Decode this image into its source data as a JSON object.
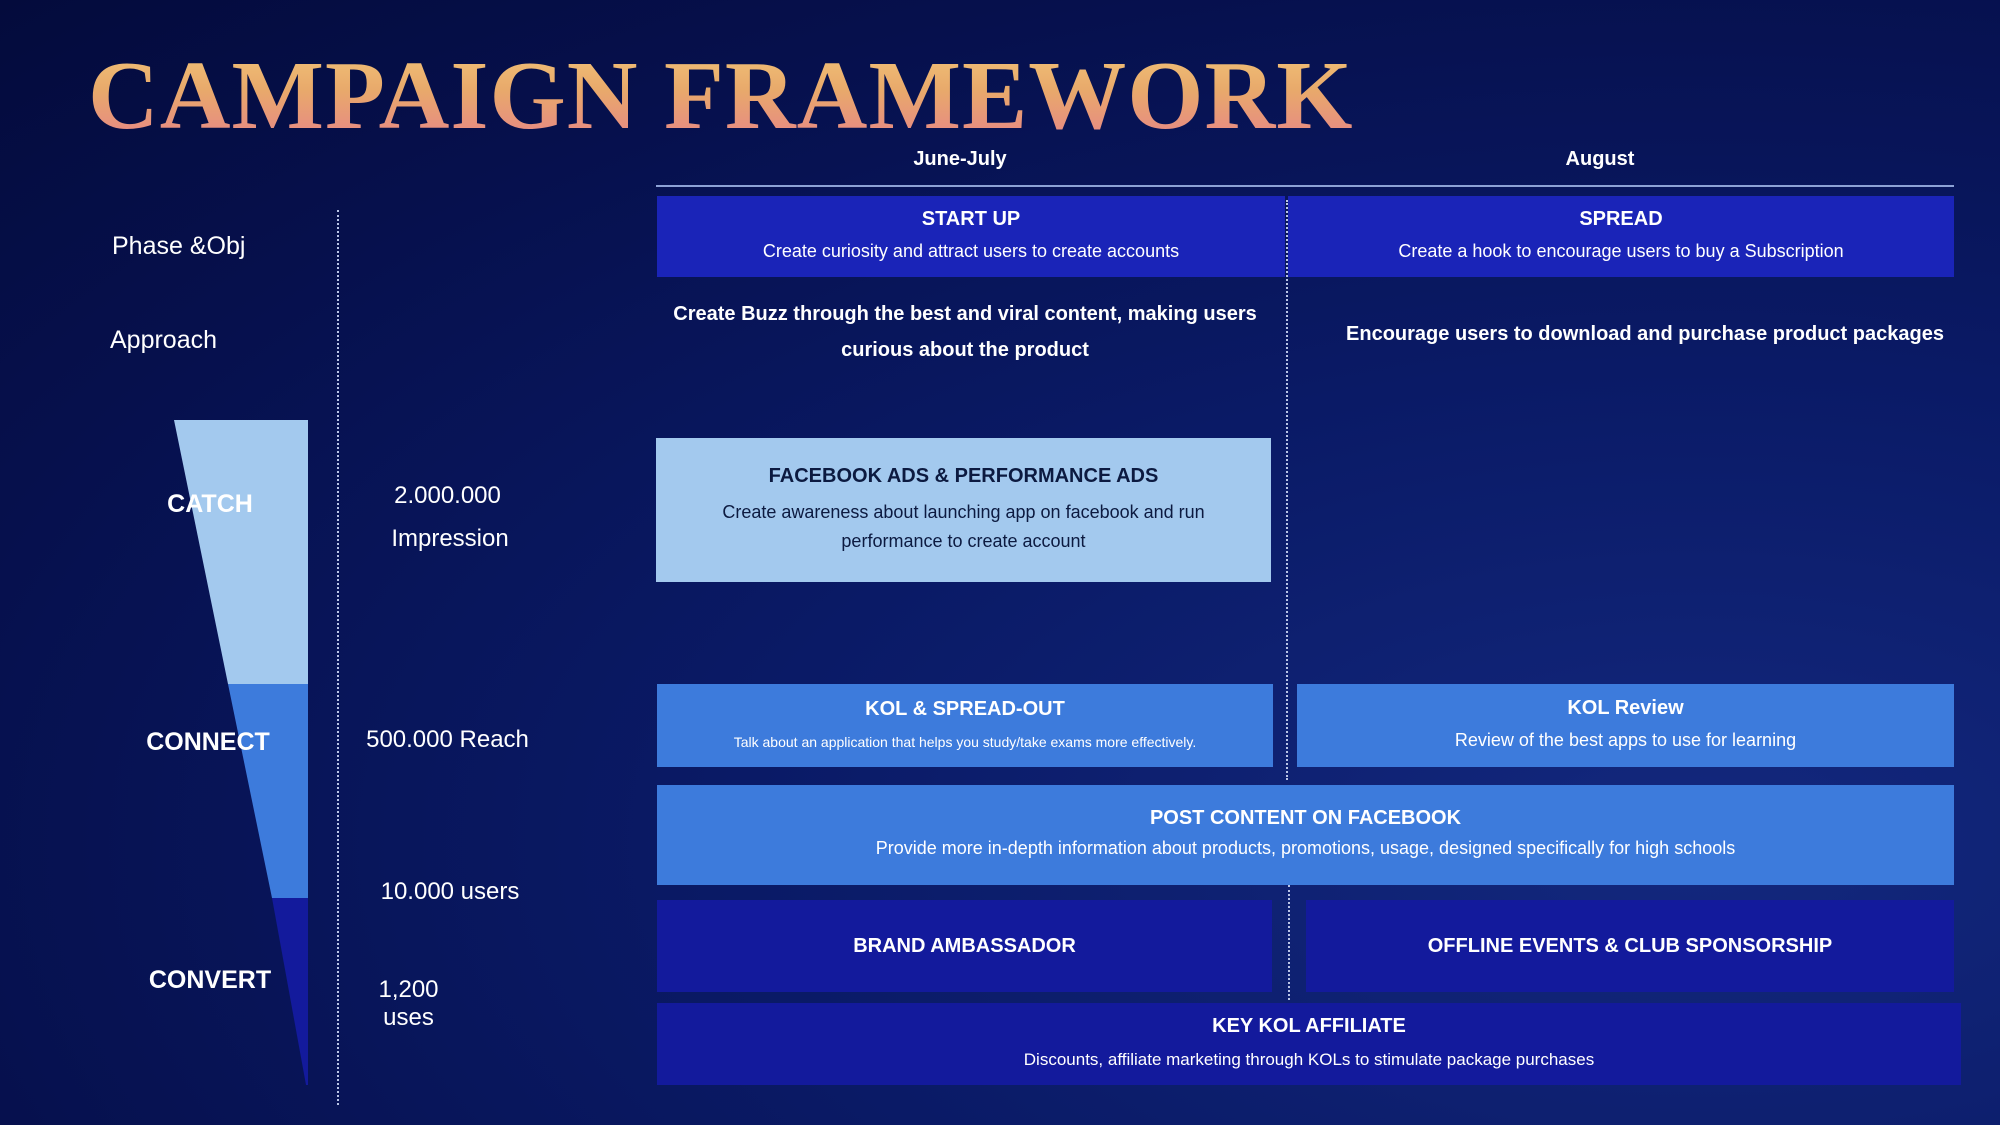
{
  "tiny_label": "",
  "title": "CAMPAIGN FRAMEWORK",
  "columns": [
    "June-July",
    "August"
  ],
  "rows": {
    "phase": "Phase &Obj",
    "approach": "Approach"
  },
  "funnel": {
    "stages": [
      {
        "label": "CATCH",
        "color": "#a3c9ee"
      },
      {
        "label": "CONNECT",
        "color": "#3d7bdc"
      },
      {
        "label": "CONVERT",
        "color": "#131a9c"
      }
    ]
  },
  "metrics": {
    "catch_value": "2.000.000",
    "catch_unit": "Impression",
    "connect": "500.000 Reach",
    "users": "10.000 users",
    "uses": "1,200 uses"
  },
  "phase": {
    "startup_title": "START UP",
    "startup_desc": "Create curiosity and attract users to create accounts",
    "spread_title": "SPREAD",
    "spread_desc": "Create a hook to encourage users to buy a Subscription"
  },
  "approach": {
    "june": "Create Buzz through the best and viral content, making users curious about the product",
    "august": "Encourage users to download and purchase product packages"
  },
  "tactics": {
    "fb_ads_title": "FACEBOOK ADS & PERFORMANCE ADS",
    "fb_ads_desc": "Create awareness about launching app on facebook and run performance to create account",
    "kol_spread_title": "KOL & SPREAD-OUT",
    "kol_spread_desc": "Talk about an application that helps you study/take exams more effectively.",
    "kol_review_title": "KOL Review",
    "kol_review_desc": "Review of the best apps to use for learning",
    "post_fb_title": "POST CONTENT ON FACEBOOK",
    "post_fb_desc": "Provide more in-depth information about products, promotions, usage, designed specifically for high schools",
    "ambassador_title": "BRAND AMBASSADOR",
    "offline_title": "OFFLINE EVENTS & CLUB SPONSORSHIP",
    "affiliate_title": "KEY KOL AFFILIATE",
    "affiliate_desc": "Discounts, affiliate marketing through KOLs to stimulate package purchases"
  },
  "colors": {
    "accent_light": "#a3c9ee",
    "accent_mid": "#3d7bdc",
    "accent_dark": "#1a24b8",
    "background": "#06104d"
  }
}
